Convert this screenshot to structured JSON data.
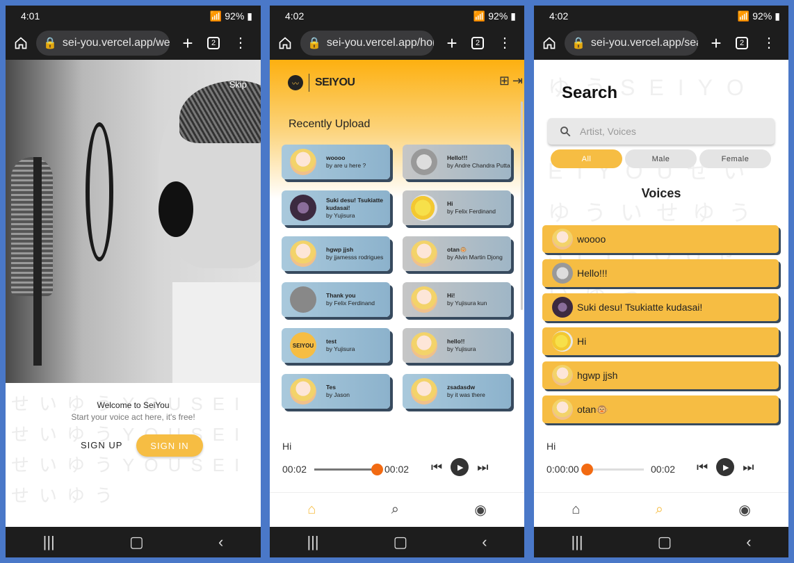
{
  "phones": [
    {
      "status": {
        "time": "4:01",
        "battery": "92%"
      },
      "browser": {
        "url": "sei-you.vercel.app/wel",
        "tabs": "2"
      },
      "skip": "Skip",
      "welcome": {
        "title": "Welcome to SeiYou",
        "subtitle": "Start your voice act here, it's free!"
      },
      "buttons": {
        "signup": "SIGN UP",
        "signin": "SIGN IN"
      }
    },
    {
      "status": {
        "time": "4:02",
        "battery": "92%"
      },
      "browser": {
        "url": "sei-you.vercel.app/hor",
        "tabs": "2"
      },
      "logo": "SEIYOU",
      "section_title": "Recently Upload",
      "uploads": [
        {
          "title": "woooo",
          "author": "by are u here ?",
          "avatar": "anime"
        },
        {
          "title": "Hello!!!",
          "author": "by Andre Chandra Putta",
          "avatar": "line"
        },
        {
          "title": "Suki desu! Tsukiatte kudasai!",
          "author": "by Yujisura",
          "avatar": "dark"
        },
        {
          "title": "Hi",
          "author": "by Felix Ferdinand",
          "avatar": "yellow"
        },
        {
          "title": "hgwp jjsh",
          "author": "by jjamesss rodrigues",
          "avatar": "anime"
        },
        {
          "title": "otan🐵",
          "author": "by Alvin Martin Djong",
          "avatar": "anime"
        },
        {
          "title": "Thank you",
          "author": "by Felix Ferdinand",
          "avatar": "grey"
        },
        {
          "title": "Hi!",
          "author": "by Yujisura kun",
          "avatar": "anime"
        },
        {
          "title": "test",
          "author": "by Yujisura",
          "avatar": "logo"
        },
        {
          "title": "hello!!",
          "author": "by Yujisura",
          "avatar": "anime"
        },
        {
          "title": "Tes",
          "author": "by Jason",
          "avatar": "anime"
        },
        {
          "title": "zsadasdw",
          "author": "by it was there",
          "avatar": "anime"
        }
      ],
      "player": {
        "song": "Hi",
        "current": "00:02",
        "duration": "00:02",
        "progress": 1.0
      }
    },
    {
      "status": {
        "time": "4:02",
        "battery": "92%"
      },
      "browser": {
        "url": "sei-you.vercel.app/sea",
        "tabs": "2"
      },
      "title": "Search",
      "search_placeholder": "Artist, Voices",
      "filters": [
        "All",
        "Male",
        "Female"
      ],
      "voices_title": "Voices",
      "voices": [
        {
          "title": "woooo",
          "avatar": "anime"
        },
        {
          "title": "Hello!!!",
          "avatar": "line"
        },
        {
          "title": "Suki desu! Tsukiatte kudasai!",
          "avatar": "dark"
        },
        {
          "title": "Hi",
          "avatar": "yellow"
        },
        {
          "title": "hgwp jjsh",
          "avatar": "anime"
        },
        {
          "title": "otan🐵",
          "avatar": "anime"
        }
      ],
      "player": {
        "song": "Hi",
        "current": "0:00:00",
        "duration": "00:02",
        "progress": 0.0
      }
    }
  ],
  "colors": {
    "accent": "#f6bd43",
    "knob": "#f26a12",
    "card_shadow": "#374a5e"
  }
}
